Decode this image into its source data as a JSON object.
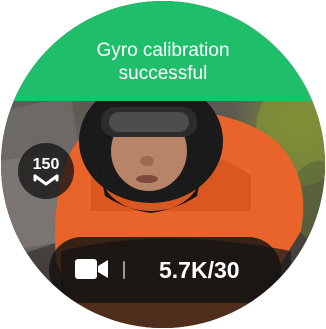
{
  "banner": {
    "line1": "Gyro calibration",
    "line2": "successful",
    "color": "#1fbe6a"
  },
  "zoom_badge": {
    "value": "150",
    "icon": "fov-chevron-icon"
  },
  "mode": {
    "icon": "video-camera-icon",
    "resolution_fps": "5.7K/30"
  }
}
